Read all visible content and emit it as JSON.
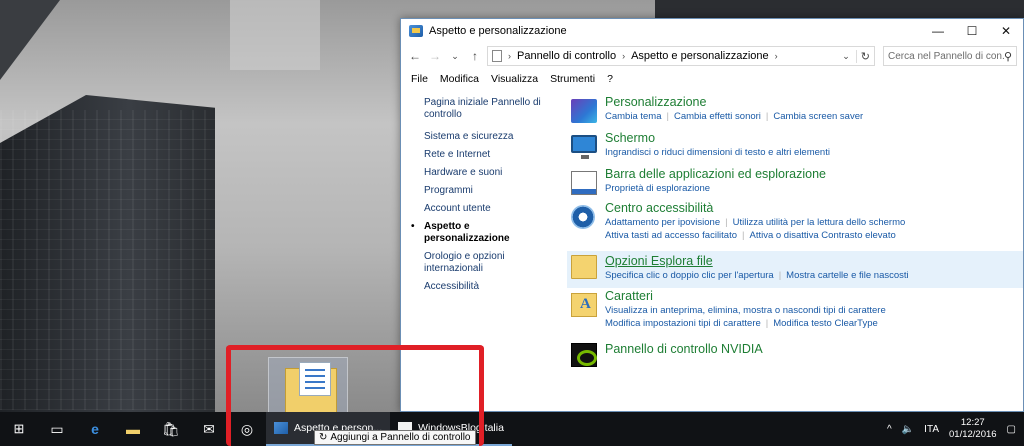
{
  "window": {
    "title": "Aspetto e personalizzazione",
    "controls": {
      "minimize": "—",
      "maximize": "☐",
      "close": "✕"
    }
  },
  "addressbar": {
    "back": "←",
    "forward": "→",
    "recent": "⌄",
    "up": "↑",
    "crumbs": [
      "Pannello di controllo",
      "Aspetto e personalizzazione"
    ],
    "separator": "›",
    "refresh": "↻",
    "search_placeholder": "Cerca nel Pannello di con..."
  },
  "menubar": [
    "File",
    "Modifica",
    "Visualizza",
    "Strumenti",
    "?"
  ],
  "leftnav": {
    "home": "Pagina iniziale Pannello di controllo",
    "items": [
      "Sistema e sicurezza",
      "Rete e Internet",
      "Hardware e suoni",
      "Programmi",
      "Account utente",
      "Aspetto e personalizzazione",
      "Orologio e opzioni internazionali",
      "Accessibilità"
    ],
    "current_index": 5
  },
  "categories": [
    {
      "title": "Personalizzazione",
      "icon": "personalization-icon",
      "links": [
        [
          "Cambia tema",
          "Cambia effetti sonori",
          "Cambia screen saver"
        ]
      ]
    },
    {
      "title": "Schermo",
      "icon": "display-icon",
      "links": [
        [
          "Ingrandisci o riduci dimensioni di testo e altri elementi"
        ]
      ]
    },
    {
      "title": "Barra delle applicazioni ed esplorazione",
      "icon": "taskbar-navigation-icon",
      "links": [
        [
          "Proprietà di esplorazione"
        ]
      ]
    },
    {
      "title": "Centro accessibilità",
      "icon": "ease-of-access-icon",
      "links": [
        [
          "Adattamento per ipovisione",
          "Utilizza utilità per la lettura dello schermo"
        ],
        [
          "Attiva tasti ad accesso facilitato",
          "Attiva o disattiva Contrasto elevato"
        ]
      ]
    },
    {
      "title": "Opzioni Esplora file",
      "icon": "folder-options-icon",
      "links": [
        [
          "Specifica clic o doppio clic per l'apertura",
          "Mostra cartelle e file nascosti"
        ]
      ]
    },
    {
      "title": "Caratteri",
      "icon": "fonts-icon",
      "links": [
        [
          "Visualizza in anteprima, elimina, mostra o nascondi tipi di carattere"
        ],
        [
          "Modifica impostazioni tipi di carattere",
          "Modifica testo ClearType"
        ]
      ]
    },
    {
      "title": "Pannello di controllo NVIDIA",
      "icon": "nvidia-icon",
      "links": []
    }
  ],
  "taskbar": {
    "tasks": [
      "Aspetto e person...",
      "WindowsBlogItalia"
    ],
    "tooltip": "Aggiungi a Pannello di controllo",
    "tooltip_icon": "↻",
    "language": "ITA",
    "time": "12:27",
    "date": "01/12/2016"
  },
  "colors": {
    "accent": "#1a5aa6",
    "category_title": "#1e7e34",
    "annotation": "#e01f26",
    "taskbar": "#101215"
  }
}
